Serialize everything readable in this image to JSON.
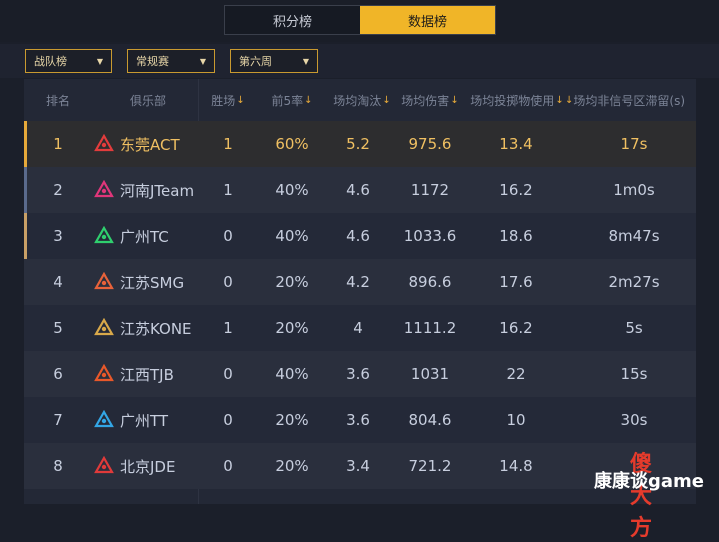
{
  "tabs": [
    {
      "label": "积分榜",
      "active": false
    },
    {
      "label": "数据榜",
      "active": true
    }
  ],
  "filters": [
    {
      "label": "战队榜"
    },
    {
      "label": "常规赛"
    },
    {
      "label": "第六周"
    }
  ],
  "table": {
    "headers": {
      "rank": "排名",
      "club": "俱乐部",
      "wins": "胜场",
      "top5": "前5率",
      "kills": "场均淘汰",
      "damage": "场均伤害",
      "throwables": "场均投掷物使用",
      "outzone": "场均非信号区滞留(s)"
    },
    "rows": [
      {
        "rank": "1",
        "club": "东莞ACT",
        "wins": "1",
        "top5": "60%",
        "kills": "5.2",
        "damage": "975.6",
        "throwables": "13.4",
        "outzone": "17s",
        "logo": "act-logo-icon",
        "logo_color": "#e23c3c"
      },
      {
        "rank": "2",
        "club": "河南JTeam",
        "wins": "1",
        "top5": "40%",
        "kills": "4.6",
        "damage": "1172",
        "throwables": "16.2",
        "outzone": "1m0s",
        "logo": "jteam-logo-icon",
        "logo_color": "#e0367a"
      },
      {
        "rank": "3",
        "club": "广州TC",
        "wins": "0",
        "top5": "40%",
        "kills": "4.6",
        "damage": "1033.6",
        "throwables": "18.6",
        "outzone": "8m47s",
        "logo": "tc-logo-icon",
        "logo_color": "#2fcf6e"
      },
      {
        "rank": "4",
        "club": "江苏SMG",
        "wins": "0",
        "top5": "20%",
        "kills": "4.2",
        "damage": "896.6",
        "throwables": "17.6",
        "outzone": "2m27s",
        "logo": "smg-logo-icon",
        "logo_color": "#e8623a"
      },
      {
        "rank": "5",
        "club": "江苏KONE",
        "wins": "1",
        "top5": "20%",
        "kills": "4",
        "damage": "1111.2",
        "throwables": "16.2",
        "outzone": "5s",
        "logo": "kone-logo-icon",
        "logo_color": "#d9a94a"
      },
      {
        "rank": "6",
        "club": "江西TJB",
        "wins": "0",
        "top5": "40%",
        "kills": "3.6",
        "damage": "1031",
        "throwables": "22",
        "outzone": "15s",
        "logo": "tjb-logo-icon",
        "logo_color": "#e8582a"
      },
      {
        "rank": "7",
        "club": "广州TT",
        "wins": "0",
        "top5": "20%",
        "kills": "3.6",
        "damage": "804.6",
        "throwables": "10",
        "outzone": "30s",
        "logo": "tt-logo-icon",
        "logo_color": "#33a6e6"
      },
      {
        "rank": "8",
        "club": "北京JDE",
        "wins": "0",
        "top5": "20%",
        "kills": "3.4",
        "damage": "721.2",
        "throwables": "14.8",
        "outzone": "",
        "logo": "jde-logo-icon",
        "logo_color": "#e03a3a"
      }
    ]
  },
  "colors": {
    "accent": "#f0b528",
    "highlight_text": "#f0c062",
    "stripe_rank1": "#e6a93a",
    "stripe_rank2": "#5a6a8c",
    "stripe_rank3": "#c9a066"
  },
  "watermark": {
    "red": "傻大方",
    "white": "康康谈game"
  }
}
